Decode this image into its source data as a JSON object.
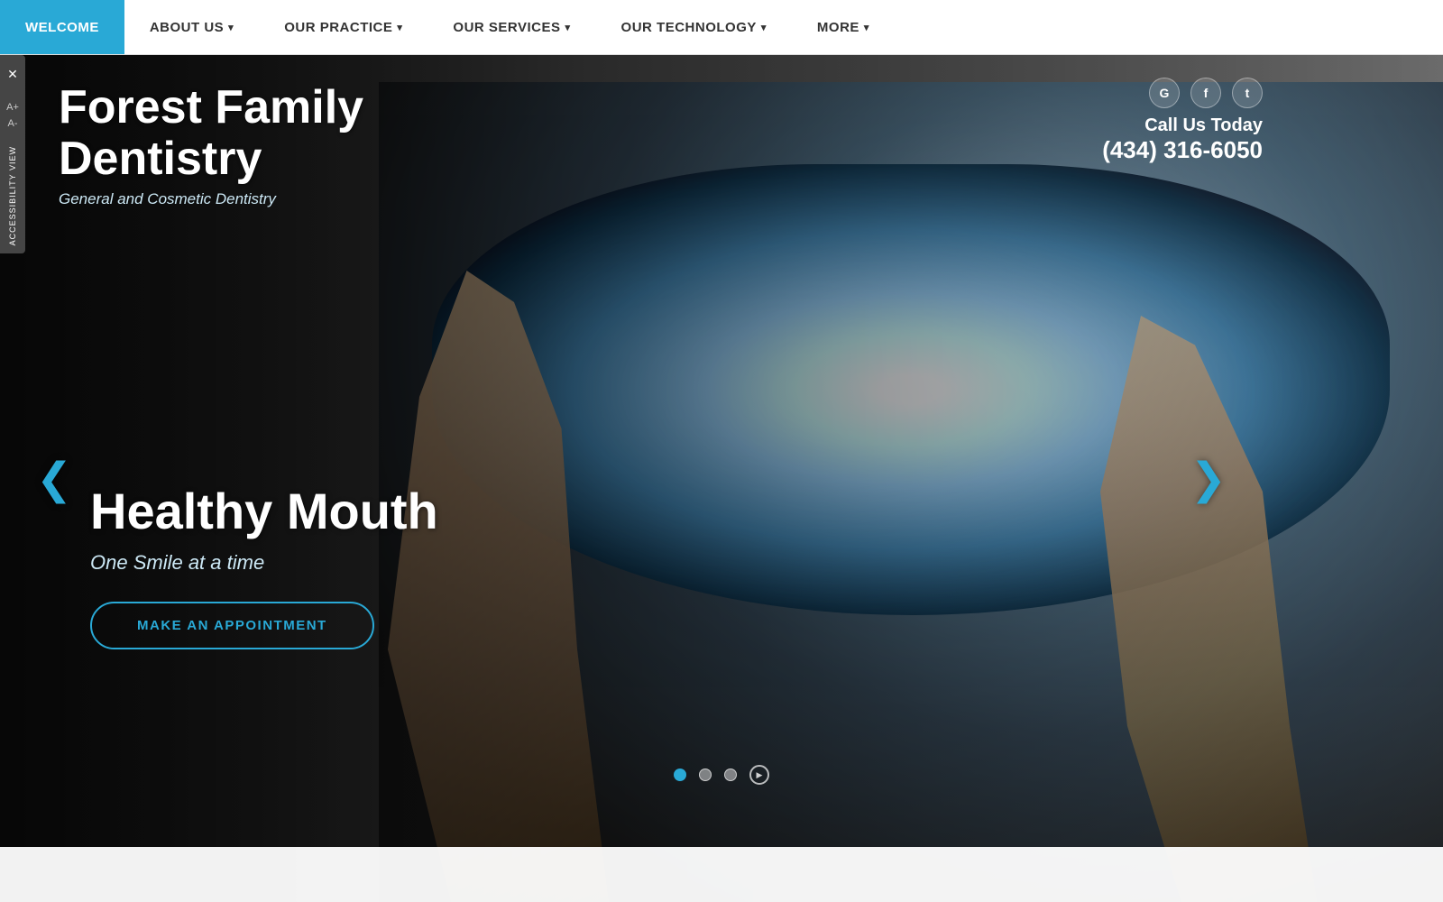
{
  "nav": {
    "items": [
      {
        "id": "welcome",
        "label": "WELCOME",
        "active": true,
        "hasDropdown": false
      },
      {
        "id": "about-us",
        "label": "ABOUT US",
        "active": false,
        "hasDropdown": true
      },
      {
        "id": "our-practice",
        "label": "OUR PRACTICE",
        "active": false,
        "hasDropdown": true
      },
      {
        "id": "our-services",
        "label": "OUR SERVICES",
        "active": false,
        "hasDropdown": true
      },
      {
        "id": "our-technology",
        "label": "OUR TECHNOLOGY",
        "active": false,
        "hasDropdown": true
      },
      {
        "id": "more",
        "label": "MORE",
        "active": false,
        "hasDropdown": true
      }
    ]
  },
  "accessibility": {
    "closeLabel": "✕",
    "viewLabel": "Accessibility View",
    "icons": [
      "A+",
      "A-",
      "☁"
    ]
  },
  "practice": {
    "name_line1": "Forest Family",
    "name_line2": "Dentistry",
    "subtitle": "General and Cosmetic Dentistry"
  },
  "contact": {
    "callLabel": "Call Us Today",
    "phone": "(434) 316-6050"
  },
  "social": {
    "google": "G",
    "facebook": "f",
    "twitter": "t"
  },
  "hero": {
    "headline": "Healthy Mouth",
    "subheadline": "One Smile at a time",
    "cta": "MAKE AN APPOINTMENT"
  },
  "carousel": {
    "dots": [
      {
        "type": "active"
      },
      {
        "type": "inactive"
      },
      {
        "type": "inactive"
      }
    ],
    "prevArrow": "❮",
    "nextArrow": "❯",
    "playIcon": "▶"
  }
}
